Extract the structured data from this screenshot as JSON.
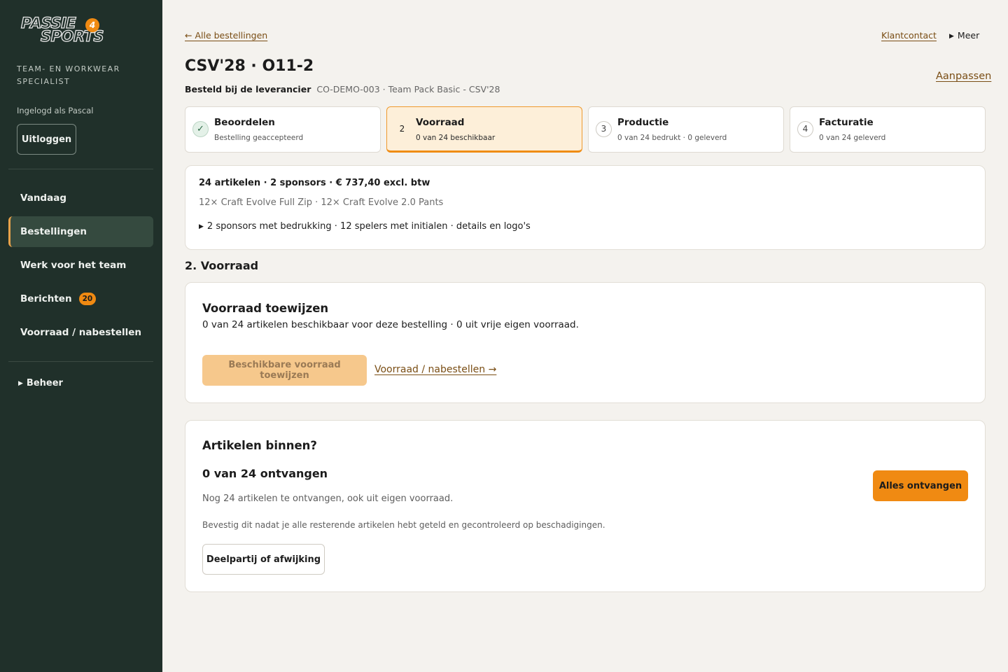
{
  "brand": {
    "logo_line1": "PASSIE",
    "logo_line2": "SPORTS",
    "logo_four": "4",
    "tagline": "TEAM- EN WORKWEAR SPECIALIST",
    "accent": "#f08a12",
    "sidebar_bg": "#20302a"
  },
  "sidebar": {
    "logged_in": "Ingelogd als Pascal",
    "logout_label": "Uitloggen",
    "items": [
      {
        "label": "Vandaag",
        "active": false
      },
      {
        "label": "Bestellingen",
        "active": true
      },
      {
        "label": "Werk voor het team",
        "active": false
      },
      {
        "label": "Berichten",
        "badge": "20",
        "active": false
      },
      {
        "label": "Voorraad / nabestellen",
        "active": false
      }
    ],
    "beheer": {
      "icon": "triangle-right-icon",
      "label": "Beheer"
    }
  },
  "header": {
    "back_link": "← Alle bestellingen",
    "klantcontact": "Klantcontact",
    "meer": "Meer",
    "title": "CSV'28 · O11-2",
    "edit_label": "Aanpassen",
    "status": "Besteld bij de leverancier",
    "reference": "CO-DEMO-003 · Team Pack Basic - CSV'28"
  },
  "steps": [
    {
      "marker": "✓",
      "name": "Beoordelen",
      "sub": "Bestelling geaccepteerd",
      "state": "done"
    },
    {
      "marker": "2",
      "name": "Voorraad",
      "sub": "0 van 24 beschikbaar",
      "state": "current"
    },
    {
      "marker": "3",
      "name": "Productie",
      "sub": "0 van 24 bedrukt · 0 geleverd",
      "state": "todo"
    },
    {
      "marker": "4",
      "name": "Facturatie",
      "sub": "0 van 24 geleverd",
      "state": "todo"
    }
  ],
  "summary": {
    "title": "24 artikelen · 2 sponsors · € 737,40 excl. btw",
    "items": "12× Craft Evolve Full Zip · 12× Craft Evolve 2.0 Pants",
    "details": "2 sponsors met bedrukking · 12 spelers met initialen · details en logo's"
  },
  "section_heading": "2. Voorraad",
  "stock_card": {
    "title": "Voorraad toewijzen",
    "text": "0 van 24 artikelen beschikbaar voor deze bestelling · 0 uit vrije eigen voorraad.",
    "assign_button": "Beschikbare voorraad toewijzen",
    "link": "Voorraad / nabestellen →"
  },
  "receive_card": {
    "title": "Artikelen binnen?",
    "count": "0 van 24 ontvangen",
    "remaining": "Nog 24 artikelen te ontvangen, ook uit eigen voorraad.",
    "instruction": "Bevestig dit nadat je alle resterende artikelen hebt geteld en gecontroleerd op beschadigingen.",
    "partial_button": "Deelpartij of afwijking",
    "receive_all_button": "Alles ontvangen"
  }
}
